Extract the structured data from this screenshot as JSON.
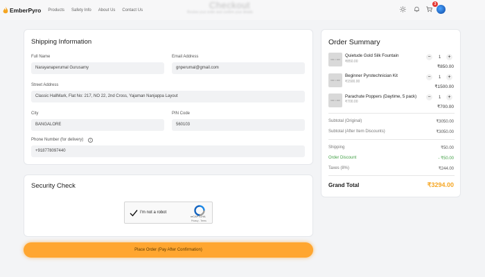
{
  "header": {
    "brand": "EmberPyro",
    "nav": [
      "Products",
      "Safety Info",
      "About Us",
      "Contact Us"
    ],
    "title_blurred": "Checkout",
    "subtitle_blurred": "Review your order and confirm your details",
    "cart_count": "3"
  },
  "shipping": {
    "title": "Shipping Information",
    "full_name_label": "Full Name",
    "full_name": "Narayanaperumal Gurusamy",
    "email_label": "Email Address",
    "email": "gnperumal@gmail.com",
    "street_label": "Street Address",
    "street": "Classic HallMark, Flat No: 217, NO 22, 2nd Cross, Yajaman Nanjappa Layout",
    "city_label": "City",
    "city": "BANGALORE",
    "pin_label": "PIN Code",
    "pin": "560103",
    "phone_label": "Phone Number (for delivery)",
    "phone": "+918778097440"
  },
  "security": {
    "title": "Security Check",
    "captcha_label": "I'm not a robot",
    "captcha_brand": "reCAPTCHA",
    "captcha_links": "Privacy - Terms"
  },
  "place_order_label": "Place Order (Pay After Confirmation)",
  "summary": {
    "title": "Order Summary",
    "img_placeholder": "600 × 400",
    "items": [
      {
        "name": "Quietude Gold Silk Fountain",
        "unit_price": "₹850.00",
        "qty": "1",
        "total": "₹850.00"
      },
      {
        "name": "Beginner Pyrotechnician Kit",
        "unit_price": "₹1500.00",
        "qty": "1",
        "total": "₹1500.00"
      },
      {
        "name": "Parachute Poppers (Daytime, 5 pack)",
        "unit_price": "₹700.00",
        "qty": "1",
        "total": "₹700.00"
      }
    ],
    "subtotal_original_label": "Subtotal (Original)",
    "subtotal_original": "₹3050.00",
    "subtotal_after_label": "Subtotal (After Item Discounts)",
    "subtotal_after": "₹3050.00",
    "shipping_label": "Shipping",
    "shipping": "₹50.00",
    "discount_label": "Order Discount",
    "discount": "- ₹50.00",
    "taxes_label": "Taxes (8%)",
    "taxes": "₹244.00",
    "grand_total_label": "Grand Total",
    "grand_total": "₹3294.00"
  }
}
